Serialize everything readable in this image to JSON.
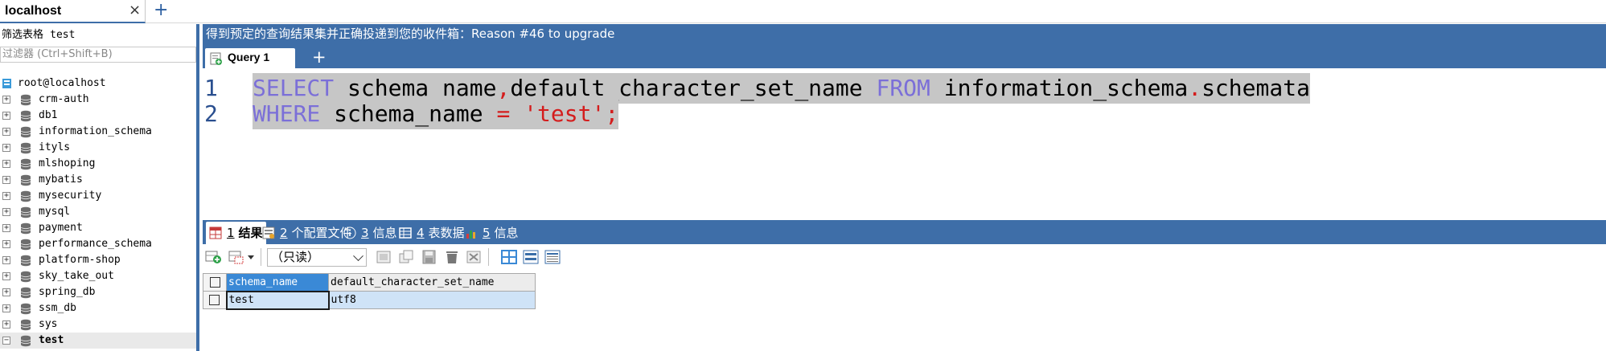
{
  "connection_tab": {
    "label": "localhost",
    "close": "×",
    "add": "+"
  },
  "sidebar": {
    "filter_label": "筛选表格",
    "filter_value": "test",
    "filter_placeholder": "过滤器 (Ctrl+Shift+B)",
    "root": "root@localhost",
    "databases": [
      {
        "name": "crm-auth",
        "expander": "+"
      },
      {
        "name": "db1",
        "expander": "+"
      },
      {
        "name": "information_schema",
        "expander": "+"
      },
      {
        "name": "ityls",
        "expander": "+"
      },
      {
        "name": "mlshoping",
        "expander": "+"
      },
      {
        "name": "mybatis",
        "expander": "+"
      },
      {
        "name": "mysecurity",
        "expander": "+"
      },
      {
        "name": "mysql",
        "expander": "+"
      },
      {
        "name": "payment",
        "expander": "+"
      },
      {
        "name": "performance_schema",
        "expander": "+"
      },
      {
        "name": "platform-shop",
        "expander": "+"
      },
      {
        "name": "sky_take_out",
        "expander": "+"
      },
      {
        "name": "spring_db",
        "expander": "+"
      },
      {
        "name": "ssm_db",
        "expander": "+"
      },
      {
        "name": "sys",
        "expander": "+"
      },
      {
        "name": "test",
        "expander": "−"
      }
    ]
  },
  "banner": "得到预定的查询结果集并正确投递到您的收件箱：Reason #46 to upgrade",
  "query_tab": {
    "label": "Query 1",
    "add": "+"
  },
  "editor": {
    "lines": [
      {
        "no": "1",
        "parts": [
          {
            "t": "SELECT",
            "c": "kw"
          },
          {
            "t": " schema_name",
            "c": ""
          },
          {
            "t": ",",
            "c": "pun"
          },
          {
            "t": "default_character_set_name ",
            "c": ""
          },
          {
            "t": "FROM",
            "c": "kw"
          },
          {
            "t": " information_schema",
            "c": ""
          },
          {
            "t": ".",
            "c": "pun"
          },
          {
            "t": "schemata",
            "c": ""
          }
        ]
      },
      {
        "no": "2",
        "parts": [
          {
            "t": "WHERE",
            "c": "kw"
          },
          {
            "t": " schema_name ",
            "c": ""
          },
          {
            "t": "=",
            "c": "pun"
          },
          {
            "t": " ",
            "c": ""
          },
          {
            "t": "'test'",
            "c": "str"
          },
          {
            "t": ";",
            "c": "pun"
          }
        ]
      }
    ]
  },
  "result_tabs": [
    {
      "num": "1",
      "label": "结果",
      "icon": "grid-icon"
    },
    {
      "num": "2",
      "label": "个配置文件",
      "icon": "profile-icon"
    },
    {
      "num": "3",
      "label": "信息",
      "icon": "info-icon"
    },
    {
      "num": "4",
      "label": "表数据",
      "icon": "table-data-icon"
    },
    {
      "num": "5",
      "label": "信息",
      "icon": "info-chart-icon"
    }
  ],
  "result_toolbar": {
    "mode": "（只读）"
  },
  "grid": {
    "columns": [
      "schema_name",
      "default_character_set_name"
    ],
    "rows": [
      [
        "test",
        "utf8"
      ]
    ]
  },
  "colors": {
    "accent": "#3e6ea8",
    "keyword": "#7b6fd8",
    "string": "#d41d1d",
    "selection": "#3a89d6"
  }
}
